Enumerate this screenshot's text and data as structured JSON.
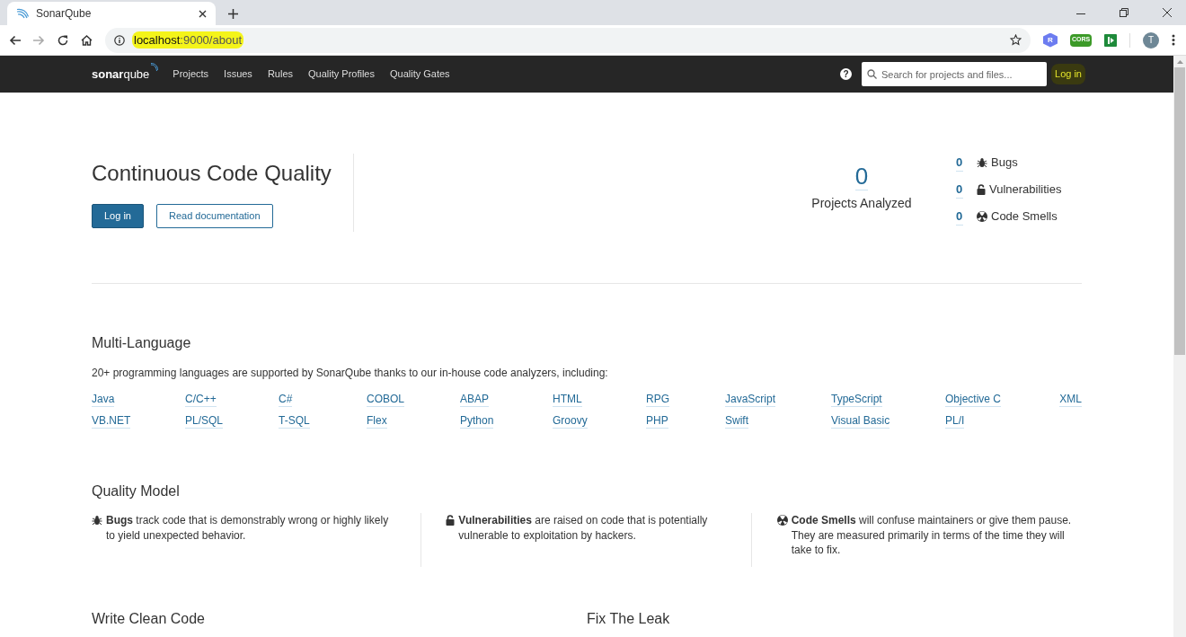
{
  "browser": {
    "tab_title": "SonarQube",
    "url_host": "localhost",
    "url_rest": ":9000/about",
    "extensions": [
      {
        "kind": "r",
        "label": "R"
      },
      {
        "kind": "cors",
        "label": "CORS"
      },
      {
        "kind": "play"
      }
    ],
    "avatar": "T"
  },
  "nav": {
    "logo_a": "sonar",
    "logo_b": "qube",
    "items": [
      "Projects",
      "Issues",
      "Rules",
      "Quality Profiles",
      "Quality Gates"
    ],
    "help": "?",
    "search": {
      "placeholder": "Search for projects and files..."
    },
    "login": "Log in"
  },
  "hero": {
    "title": "Continuous Code Quality",
    "login_button": "Log in",
    "docs_button": "Read documentation",
    "projects_count": "0",
    "projects_label": "Projects Analyzed",
    "issues": [
      {
        "kind": "bug",
        "count": "0",
        "label": "Bugs"
      },
      {
        "kind": "vulnerability",
        "count": "0",
        "label": "Vulnerabilities"
      },
      {
        "kind": "smell",
        "count": "0",
        "label": "Code Smells"
      }
    ]
  },
  "languages": {
    "title": "Multi-Language",
    "intro": "20+ programming languages are supported by SonarQube thanks to our in-house code analyzers, including:",
    "items": [
      "Java",
      "C/C++",
      "C#",
      "COBOL",
      "ABAP",
      "HTML",
      "RPG",
      "JavaScript",
      "TypeScript",
      "Objective C",
      "XML",
      "VB.NET",
      "PL/SQL",
      "T-SQL",
      "Flex",
      "Python",
      "Groovy",
      "PHP",
      "Swift",
      "Visual Basic",
      "PL/I"
    ]
  },
  "quality_model": {
    "title": "Quality Model",
    "items": [
      {
        "kind": "bug",
        "text": "**Bugs** track code that is demonstrably wrong or highly likely to yield unexpected behavior."
      },
      {
        "kind": "vulnerability",
        "text": "**Vulnerabilities** are raised on code that is potentially vulnerable to exploitation by hackers."
      },
      {
        "kind": "smell",
        "text": "**Code Smells** will confuse maintainers or give them pause. They are measured primarily in terms of the time they will take to fix."
      }
    ]
  },
  "bottom_sections": [
    "Write Clean Code",
    "Fix The Leak"
  ]
}
